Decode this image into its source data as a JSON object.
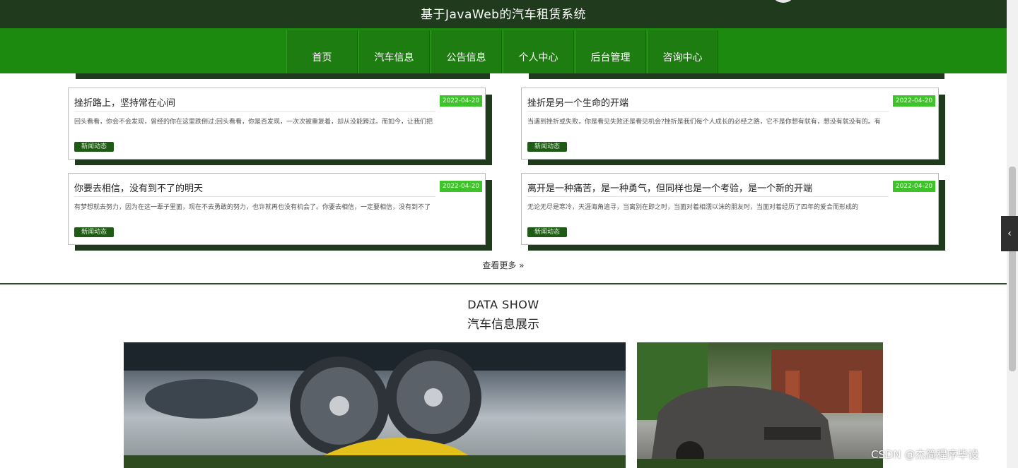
{
  "header": {
    "title": "基于JavaWeb的汽车租赁系统"
  },
  "nav": {
    "items": [
      {
        "label": "首页"
      },
      {
        "label": "汽车信息"
      },
      {
        "label": "公告信息"
      },
      {
        "label": "个人中心"
      },
      {
        "label": "后台管理"
      },
      {
        "label": "咨询中心"
      }
    ]
  },
  "news": {
    "cards": [
      {
        "title": "挫折路上，坚持常在心间",
        "date": "2022-04-20",
        "summary": "回头看看，你会不会发现，曾经的你在这里跌倒过;回头看看，你是否发现，一次次被重复着，却从没能跨过。而如今，让我们把",
        "tag": "新闻动态"
      },
      {
        "title": "挫折是另一个生命的开端",
        "date": "2022-04-20",
        "summary": "当遇到挫折或失败，你是看见失败还是看见机会?挫折是我们每个人成长的必经之路，它不是你想有就有，想没有就没有的。有",
        "tag": "新闻动态"
      },
      {
        "title": "你要去相信，没有到不了的明天",
        "date": "2022-04-20",
        "summary": "有梦想就去努力，因为在这一辈子里面，现在不去勇敢的努力，也许就再也没有机会了。你要去相信，一定要相信，没有到不了",
        "tag": "新闻动态"
      },
      {
        "title": "离开是一种痛苦，是一种勇气，但同样也是一个考验，是一个新的开端",
        "date": "2022-04-20",
        "summary": "无论无尽是寒冷，天涯海角追寻，当离别在即之时，当面对着相濡以沫的朋友时，当面对着经历了四年的爱合而形成的",
        "tag": "新闻动态"
      }
    ],
    "more_label": "查看更多 »"
  },
  "section": {
    "title_en": "DATA SHOW",
    "title_cn": "汽车信息展示"
  },
  "side_tab": {
    "label": "‹"
  },
  "watermark": "CSDN @杰简程序毕设",
  "colors": {
    "header_bg": "#1f3a1c",
    "nav_bg": "#1b8a0f",
    "date_badge": "#3ec32a",
    "tag_bg": "#1f5a16"
  }
}
